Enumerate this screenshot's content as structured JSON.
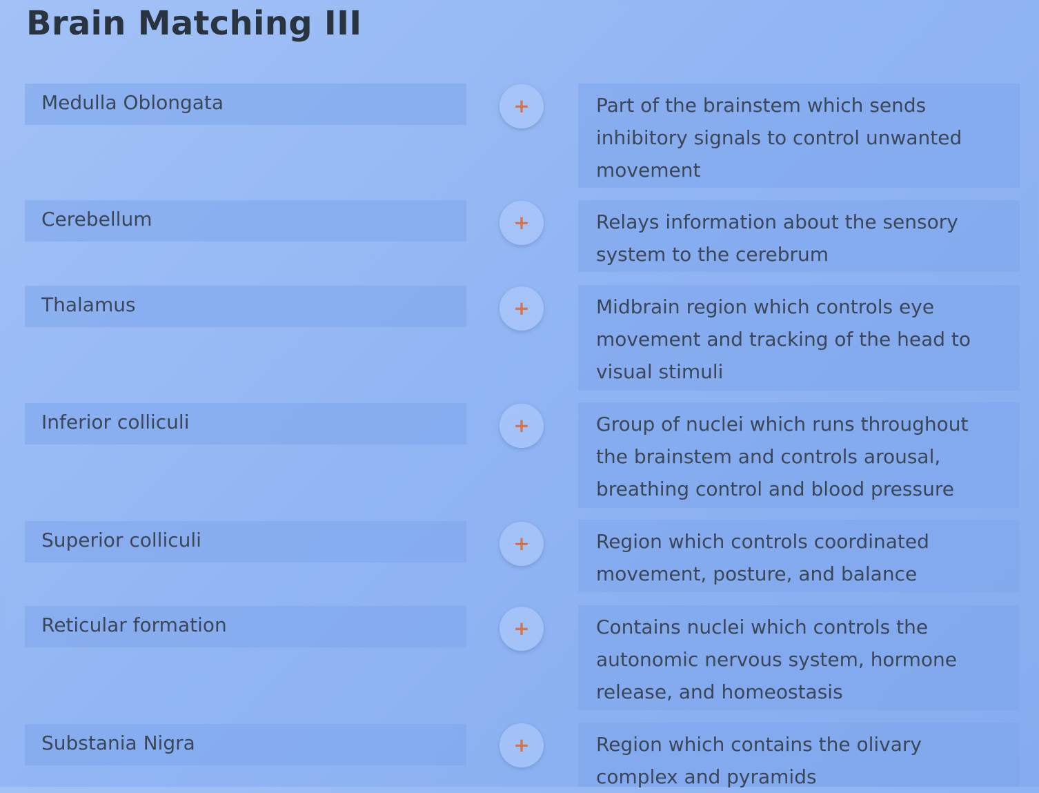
{
  "page": {
    "title": "Brain Matching III"
  },
  "colors": {
    "background": "#92b6f4",
    "card": "#7da5eb",
    "plus_accent": "#d5734a",
    "text": "#3b4658"
  },
  "icons": {
    "add": "plus-icon"
  },
  "terms": [
    {
      "label": "Medulla Oblongata"
    },
    {
      "label": "Cerebellum"
    },
    {
      "label": "Thalamus"
    },
    {
      "label": "Inferior colliculi"
    },
    {
      "label": "Superior colliculi"
    },
    {
      "label": "Reticular formation"
    },
    {
      "label": "Substania Nigra"
    }
  ],
  "add_buttons": [
    {
      "symbol": "+"
    },
    {
      "symbol": "+"
    },
    {
      "symbol": "+"
    },
    {
      "symbol": "+"
    },
    {
      "symbol": "+"
    },
    {
      "symbol": "+"
    },
    {
      "symbol": "+"
    }
  ],
  "definitions": [
    {
      "text": "Part of the brainstem which sends inhibitory signals to control unwanted movement"
    },
    {
      "text": "Relays information about the sensory system to the cerebrum"
    },
    {
      "text": "Midbrain region which controls eye movement and tracking of the head to visual stimuli"
    },
    {
      "text": "Group of nuclei which runs throughout the brainstem and controls arousal, breathing control and blood pressure"
    },
    {
      "text": "Region which controls coordinated movement, posture, and balance"
    },
    {
      "text": "Contains nuclei which controls the autonomic nervous system, hormone release, and homeostasis"
    },
    {
      "text": "Region which contains the olivary complex and pyramids"
    }
  ]
}
